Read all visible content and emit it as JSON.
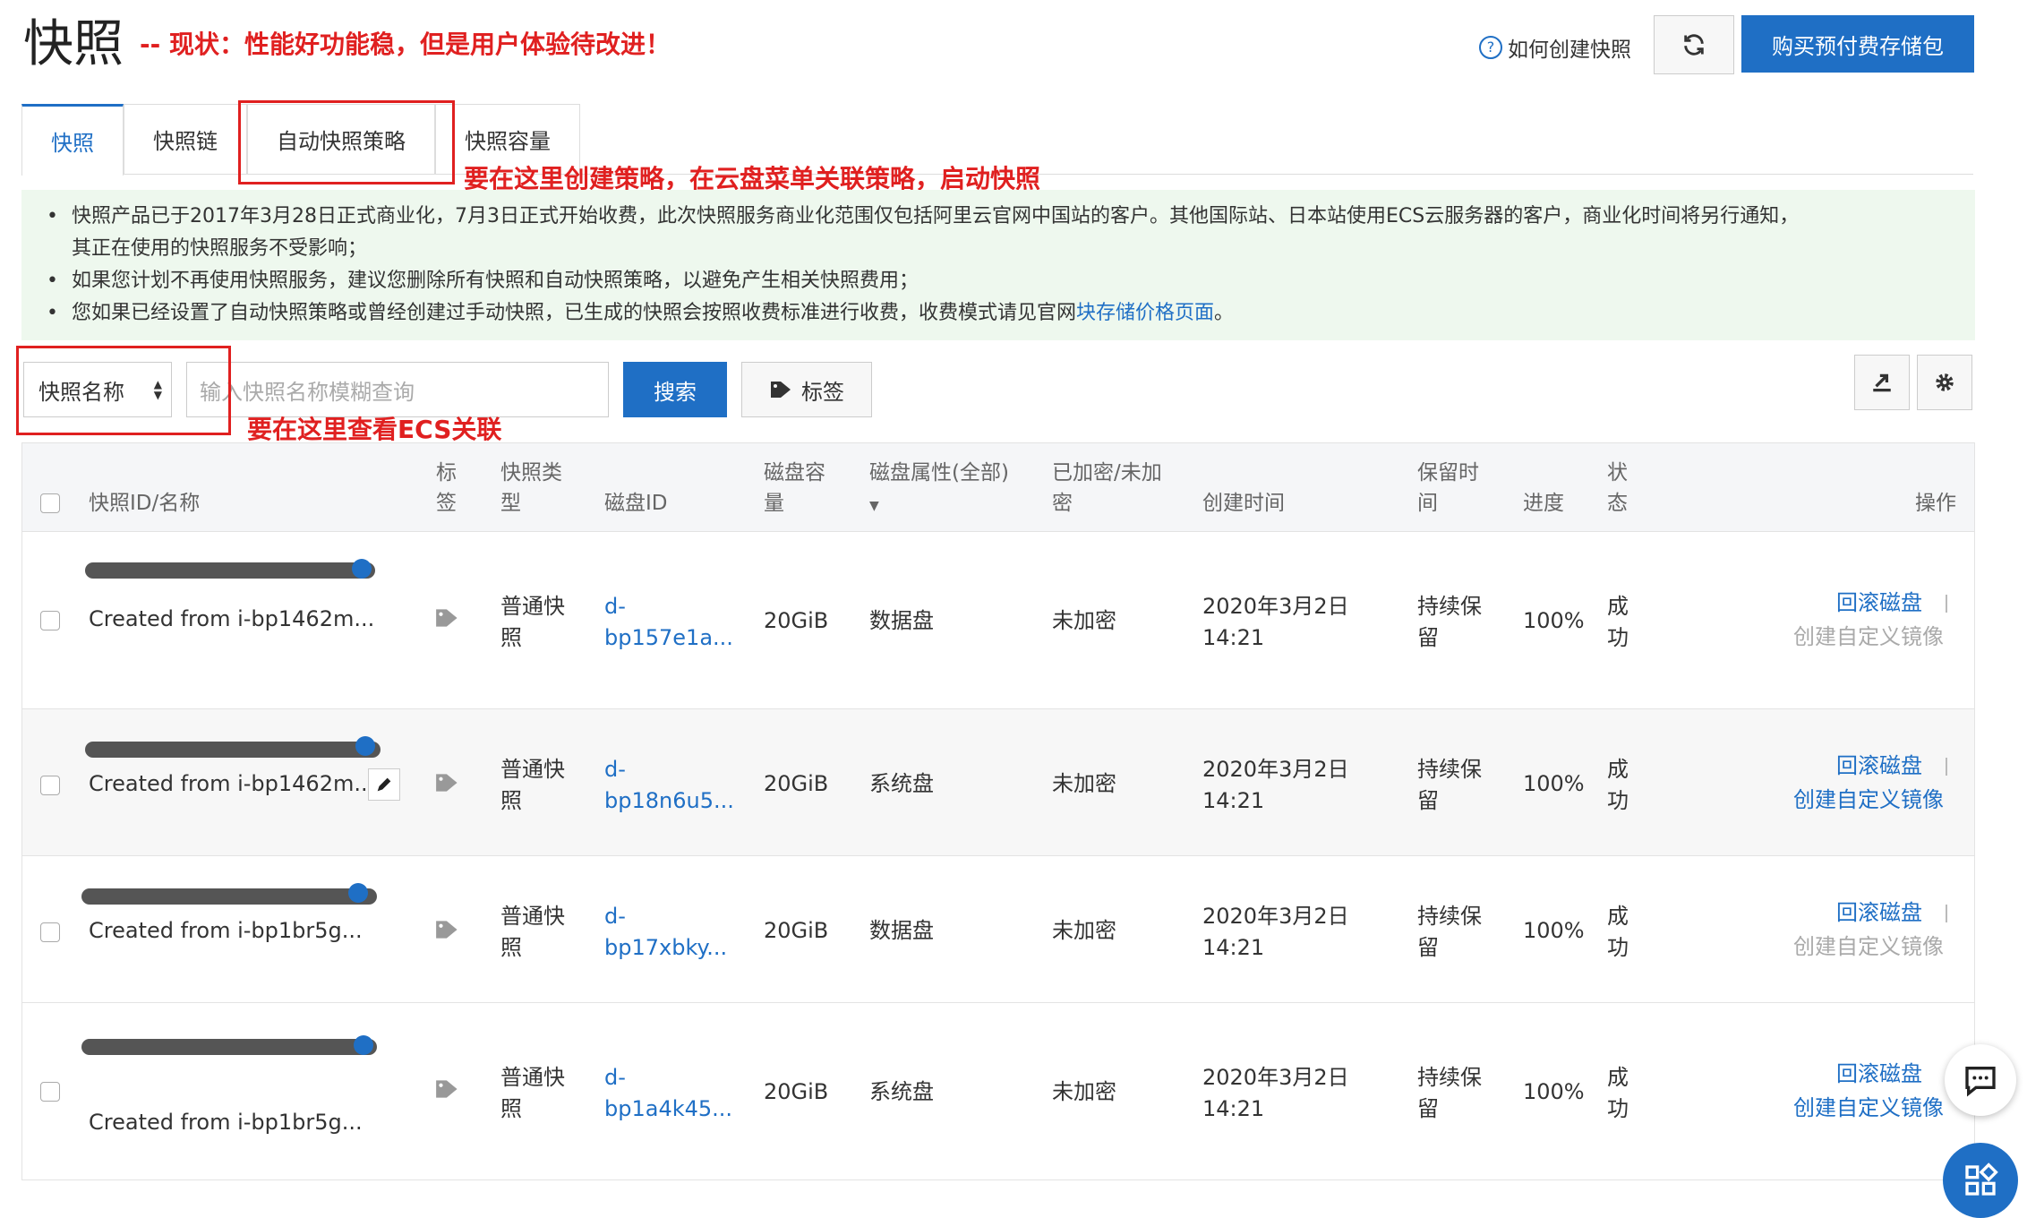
{
  "header": {
    "title": "快照",
    "annotation": "-- 现状：性能好功能稳，但是用户体验待改进！",
    "help_link": "如何创建快照",
    "buy_button": "购买预付费存储包"
  },
  "tabs": [
    {
      "label": "快照"
    },
    {
      "label": "快照链"
    },
    {
      "label": "自动快照策略"
    },
    {
      "label": "快照容量"
    }
  ],
  "annotations": {
    "policy": "要在这里创建策略，在云盘菜单关联策略，启动快照",
    "ecs": "要在这里查看ECS关联"
  },
  "notice": {
    "item1": "快照产品已于2017年3月28日正式商业化，7月3日正式开始收费，此次快照服务商业化范围仅包括阿里云官网中国站的客户。其他国际站、日本站使用ECS云服务器的客户，商业化时间将另行通知，",
    "item1b": "其正在使用的快照服务不受影响；",
    "item2": "如果您计划不再使用快照服务，建议您删除所有快照和自动快照策略，以避免产生相关快照费用；",
    "item3": "您如果已经设置了自动快照策略或曾经创建过手动快照，已生成的快照会按照收费标准进行收费，收费模式请见官网",
    "item3_link": "块存储价格页面",
    "item3_end": "。"
  },
  "filter": {
    "select_value": "快照名称",
    "placeholder": "输入快照名称模糊查询",
    "search_button": "搜索",
    "tag_button": "标签"
  },
  "table": {
    "headers": {
      "id": "快照ID/名称",
      "tag1": "标",
      "tag2": "签",
      "type1": "快照类",
      "type2": "型",
      "disk_id": "磁盘ID",
      "cap1": "磁盘容",
      "cap2": "量",
      "attr": "磁盘属性(全部)",
      "enc1": "已加密/未加",
      "enc2": "密",
      "created": "创建时间",
      "ret1": "保留时",
      "ret2": "间",
      "progress": "进度",
      "status1": "状",
      "status2": "态",
      "ops": "操作"
    },
    "rows": [
      {
        "desc": "Created from i-bp1462m...",
        "type1": "普通快",
        "type2": "照",
        "disk1": "d-",
        "disk2": "bp157e1a...",
        "cap": "20GiB",
        "attr": "数据盘",
        "enc": "未加密",
        "date": "2020年3月2日",
        "time": "14:21",
        "ret1": "持续保",
        "ret2": "留",
        "progress": "100%",
        "st1": "成",
        "st2": "功",
        "rollback": "回滚磁盘",
        "image": "创建自定义镜像"
      },
      {
        "desc": "Created from i-bp1462m...",
        "type1": "普通快",
        "type2": "照",
        "disk1": "d-",
        "disk2": "bp18n6u5...",
        "cap": "20GiB",
        "attr": "系统盘",
        "enc": "未加密",
        "date": "2020年3月2日",
        "time": "14:21",
        "ret1": "持续保",
        "ret2": "留",
        "progress": "100%",
        "st1": "成",
        "st2": "功",
        "rollback": "回滚磁盘",
        "image": "创建自定义镜像"
      },
      {
        "desc": "Created from i-bp1br5g...",
        "type1": "普通快",
        "type2": "照",
        "disk1": "d-",
        "disk2": "bp17xbky...",
        "cap": "20GiB",
        "attr": "数据盘",
        "enc": "未加密",
        "date": "2020年3月2日",
        "time": "14:21",
        "ret1": "持续保",
        "ret2": "留",
        "progress": "100%",
        "st1": "成",
        "st2": "功",
        "rollback": "回滚磁盘",
        "image": "创建自定义镜像"
      },
      {
        "desc": "Created from i-bp1br5g...",
        "type1": "普通快",
        "type2": "照",
        "disk1": "d-",
        "disk2": "bp1a4k45...",
        "cap": "20GiB",
        "attr": "系统盘",
        "enc": "未加密",
        "date": "2020年3月2日",
        "time": "14:21",
        "ret1": "持续保",
        "ret2": "留",
        "progress": "100%",
        "st1": "成",
        "st2": "功",
        "rollback": "回滚磁盘",
        "image": "创建自定义镜像"
      }
    ]
  },
  "colors": {
    "accent": "#1f6fc5",
    "annotation": "#e02020",
    "notice_bg": "#eef8ee"
  }
}
